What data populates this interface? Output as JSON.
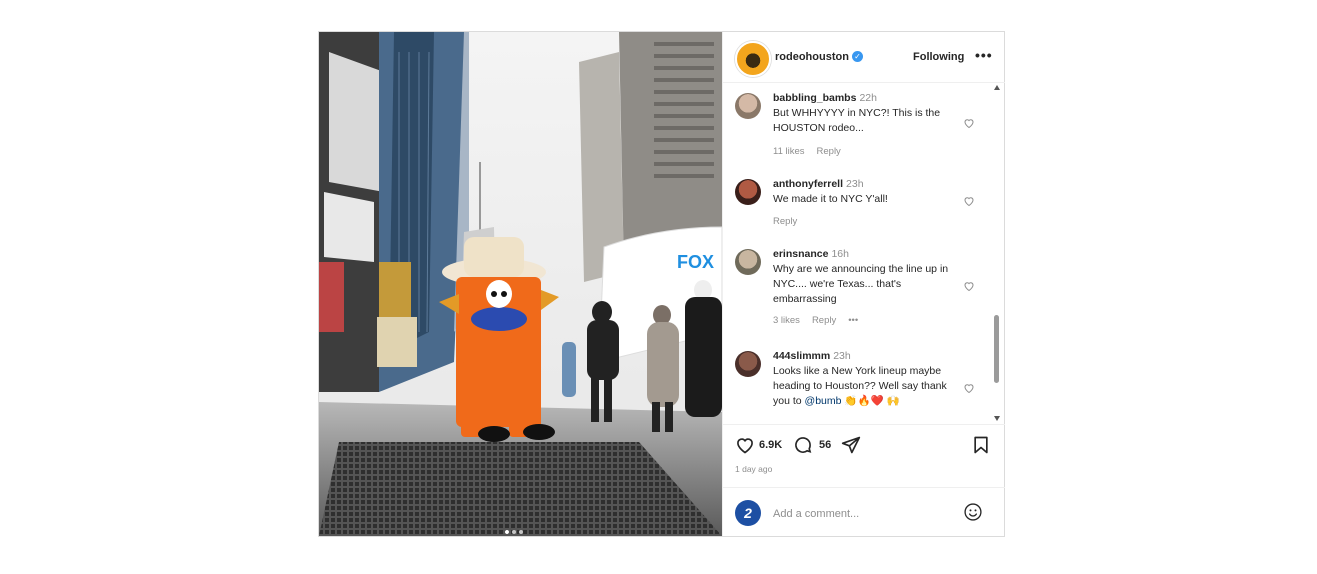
{
  "post": {
    "account": {
      "username": "rodeohouston",
      "verified_icon": "verified-badge-icon",
      "follow_state": "Following",
      "more_icon": "more-options-icon"
    },
    "photo": {
      "billboard_text": "FOX",
      "carousel_dots": 3,
      "active_dot": 0
    },
    "comments": [
      {
        "username": "babbling_bambs",
        "time": "22h",
        "text": "But WHHYYYY in NYC?! This is the HOUSTON rodeo...",
        "likes": "11 likes",
        "reply": "Reply"
      },
      {
        "username": "anthonyferrell",
        "time": "23h",
        "text": "We made it to NYC Y'all!",
        "likes": "",
        "reply": "Reply"
      },
      {
        "username": "erinsnance",
        "time": "16h",
        "text": "Why are we announcing the line up in NYC.... we're Texas... that's embarrassing",
        "likes": "3 likes",
        "reply": "Reply",
        "more": "•••"
      },
      {
        "username": "444slimmm",
        "time": "23h",
        "text_before": "Looks like a New York lineup maybe heading to Houston?? Well say thank you to ",
        "mention": "@bumb",
        "text_after": " 👏🔥❤️ 🙌"
      }
    ],
    "actions": {
      "likes_count": "6.9K",
      "comments_count": "56",
      "time_ago": "1 day ago",
      "icons": [
        "heart-icon",
        "comment-icon",
        "share-icon",
        "bookmark-icon"
      ]
    },
    "add_comment": {
      "placeholder": "Add a comment...",
      "avatar_label": "2"
    }
  },
  "colors": {
    "accent": "#3897f0",
    "text": "#262626",
    "muted": "#8e8e8e",
    "heart_red": "#ed4956"
  }
}
